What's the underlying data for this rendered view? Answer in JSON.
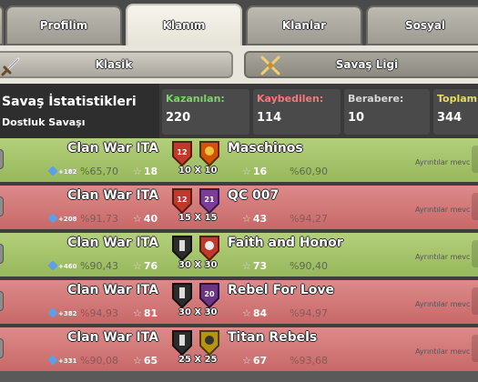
{
  "tabs": [
    {
      "label": "Profilim",
      "active": false
    },
    {
      "label": "Klanım",
      "active": true
    },
    {
      "label": "Klanlar",
      "active": false
    },
    {
      "label": "Sosyal",
      "active": false
    }
  ],
  "subtabs": {
    "classic": "Klasik",
    "war_league": "Savaş Ligi"
  },
  "stats": {
    "title": "Savaş İstatistikleri",
    "subtitle": "Dostluk Savaşı",
    "won_label": "Kazanılan:",
    "won": "220",
    "lost_label": "Kaybedilen:",
    "lost": "114",
    "draw_label": "Berabere:",
    "draw": "10",
    "total_label": "Toplam",
    "total": "344"
  },
  "colors": {
    "win_row": "#a8c46c",
    "loss_row": "#d47878",
    "won_label": "#7ed36a",
    "lost_label": "#f07a7a",
    "draw_label": "#d8d8d8",
    "total_label": "#e8d870"
  },
  "wars": [
    {
      "result": "win",
      "clan": "Clan War ITA",
      "opponent": "Maschinos",
      "size": "10 X 10",
      "xp": "+182",
      "pct_us": "%65,70",
      "stars_us": "18",
      "stars_opp": "16",
      "pct_opp": "%60,90",
      "detail": "Ayrıntılar mevc"
    },
    {
      "result": "loss",
      "clan": "Clan War ITA",
      "opponent": "QC 007",
      "size": "15 X 15",
      "xp": "+208",
      "pct_us": "%91,73",
      "stars_us": "40",
      "stars_opp": "43",
      "pct_opp": "%94,27",
      "detail": "Ayrıntılar mevc"
    },
    {
      "result": "win",
      "clan": "Clan War ITA",
      "opponent": "Faith and Honor",
      "size": "30 X 30",
      "xp": "+460",
      "pct_us": "%90,43",
      "stars_us": "76",
      "stars_opp": "73",
      "pct_opp": "%90,40",
      "detail": "Ayrıntılar mevc"
    },
    {
      "result": "loss",
      "clan": "Clan War ITA",
      "opponent": "Rebel For Love",
      "size": "30 X 30",
      "xp": "+382",
      "pct_us": "%94,93",
      "stars_us": "81",
      "stars_opp": "84",
      "pct_opp": "%94,97",
      "detail": "Ayrıntılar mevc"
    },
    {
      "result": "loss",
      "clan": "Clan War ITA",
      "opponent": "Titan Rebels",
      "size": "25 X 25",
      "xp": "+331",
      "pct_us": "%90,08",
      "stars_us": "65",
      "stars_opp": "67",
      "pct_opp": "%93,68",
      "detail": "Ayrıntılar mevc"
    }
  ]
}
